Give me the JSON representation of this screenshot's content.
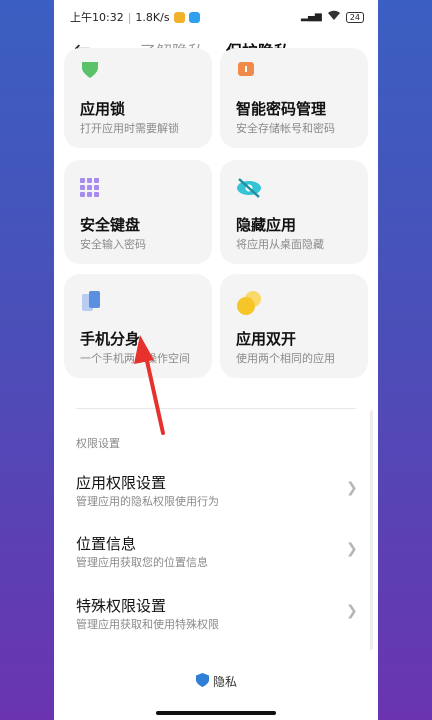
{
  "status": {
    "time": "上午10:32",
    "speed": "1.8K/s",
    "battery": "24"
  },
  "header": {
    "tab_learn": "了解隐私",
    "tab_protect": "保护隐私"
  },
  "cards": [
    {
      "title": "应用锁",
      "desc": "打开应用时需要解锁",
      "icon": "shield-lock-icon"
    },
    {
      "title": "智能密码管理",
      "desc": "安全存储帐号和密码",
      "icon": "password-icon"
    },
    {
      "title": "安全键盘",
      "desc": "安全输入密码",
      "icon": "keyboard-icon"
    },
    {
      "title": "隐藏应用",
      "desc": "将应用从桌面隐藏",
      "icon": "eye-hidden-icon"
    },
    {
      "title": "手机分身",
      "desc": "一个手机两个操作空间",
      "icon": "second-space-icon"
    },
    {
      "title": "应用双开",
      "desc": "使用两个相同的应用",
      "icon": "dual-apps-icon"
    }
  ],
  "section": {
    "title": "权限设置"
  },
  "rows": [
    {
      "title": "应用权限设置",
      "desc": "管理应用的隐私权限使用行为"
    },
    {
      "title": "位置信息",
      "desc": "管理应用获取您的位置信息"
    },
    {
      "title": "特殊权限设置",
      "desc": "管理应用获取和使用特殊权限"
    }
  ],
  "footer": {
    "label": "隐私"
  },
  "colors": {
    "accent_green": "#5cc26a",
    "accent_orange": "#f08a4b",
    "accent_purple": "#a78bf0",
    "accent_teal": "#36c3d6",
    "accent_blue": "#5b8fe0",
    "accent_yellow": "#f6c528",
    "arrow_red": "#e6312d"
  }
}
